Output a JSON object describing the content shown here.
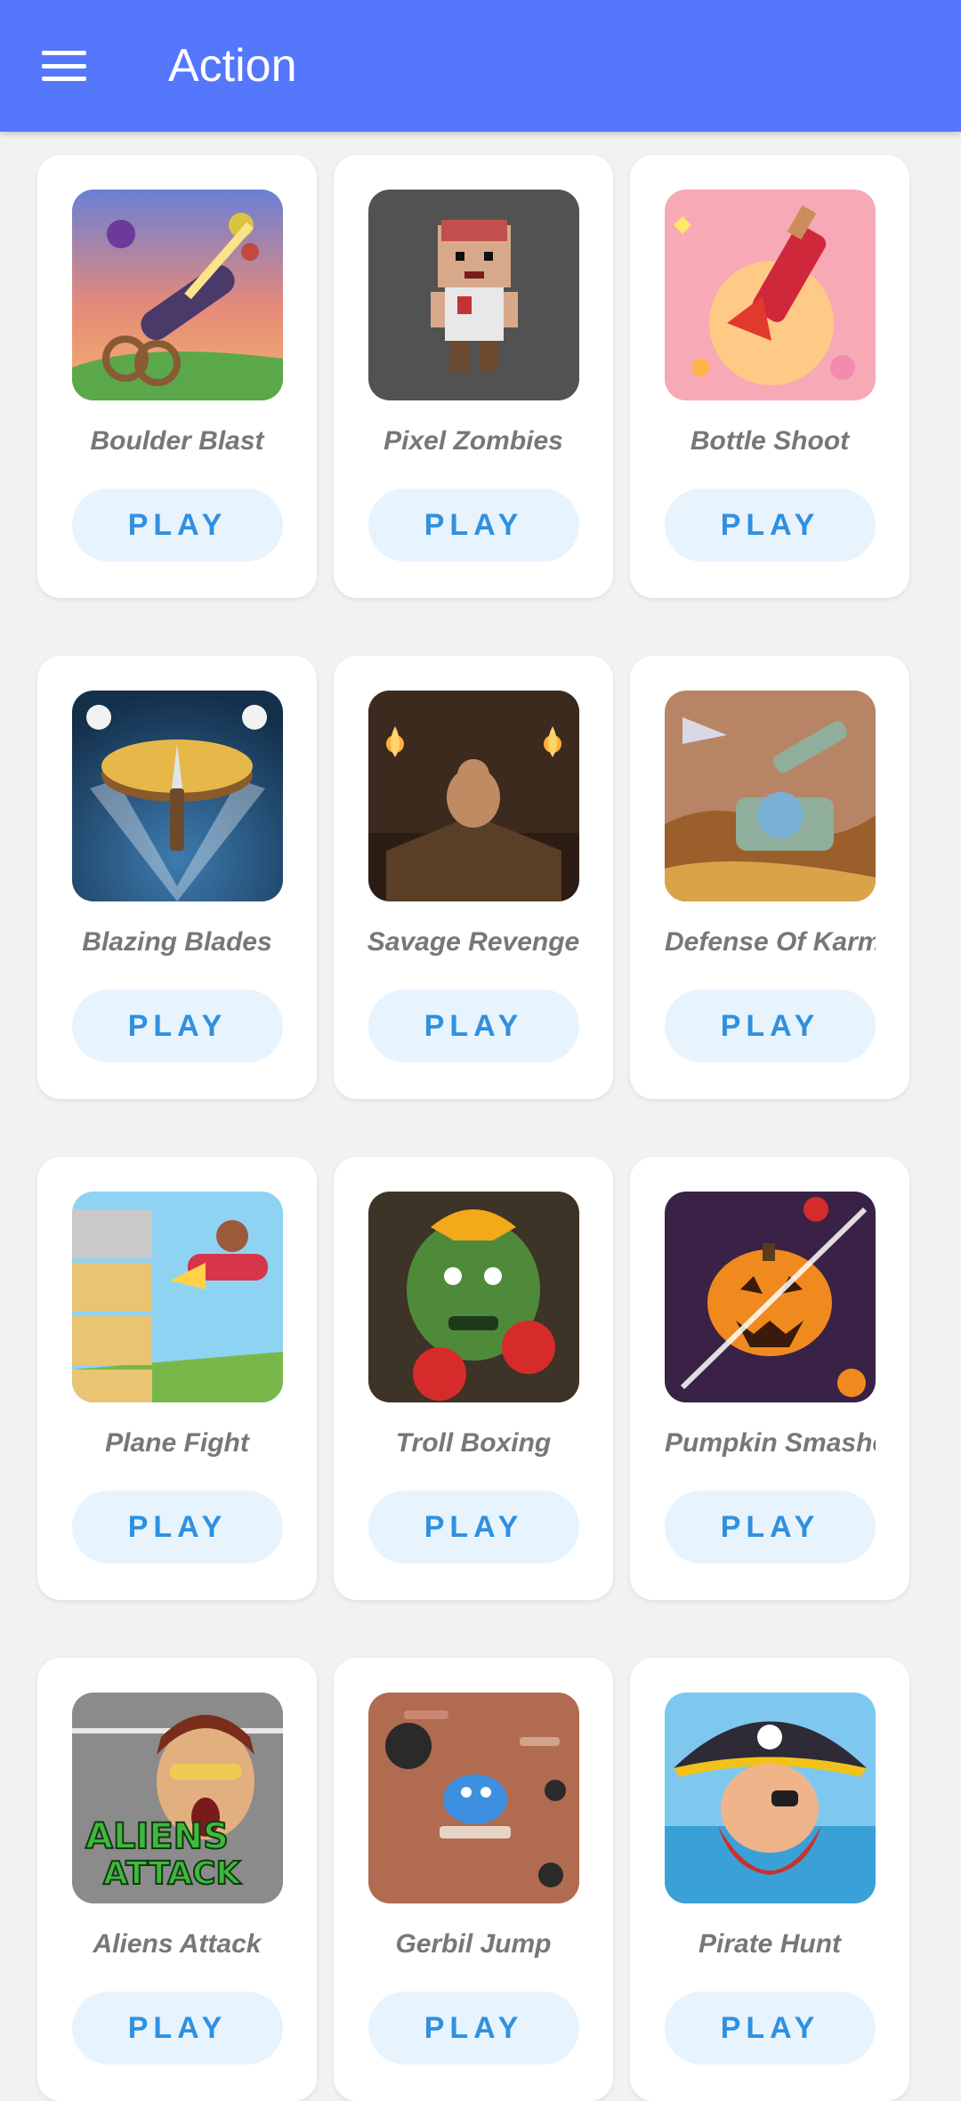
{
  "header": {
    "title": "Action",
    "menu_icon": "hamburger-menu-icon",
    "background_color": "#5577fb"
  },
  "play_label": "PLAY",
  "games": [
    {
      "name": "Boulder Blast"
    },
    {
      "name": "Pixel Zombies"
    },
    {
      "name": "Bottle Shoot"
    },
    {
      "name": "Blazing Blades"
    },
    {
      "name": "Savage Revenge"
    },
    {
      "name": "Defense Of Karm"
    },
    {
      "name": "Plane Fight"
    },
    {
      "name": "Troll Boxing"
    },
    {
      "name": "Pumpkin Smashe"
    },
    {
      "name": "Aliens Attack"
    },
    {
      "name": "Gerbil Jump"
    },
    {
      "name": "Pirate Hunt"
    }
  ]
}
